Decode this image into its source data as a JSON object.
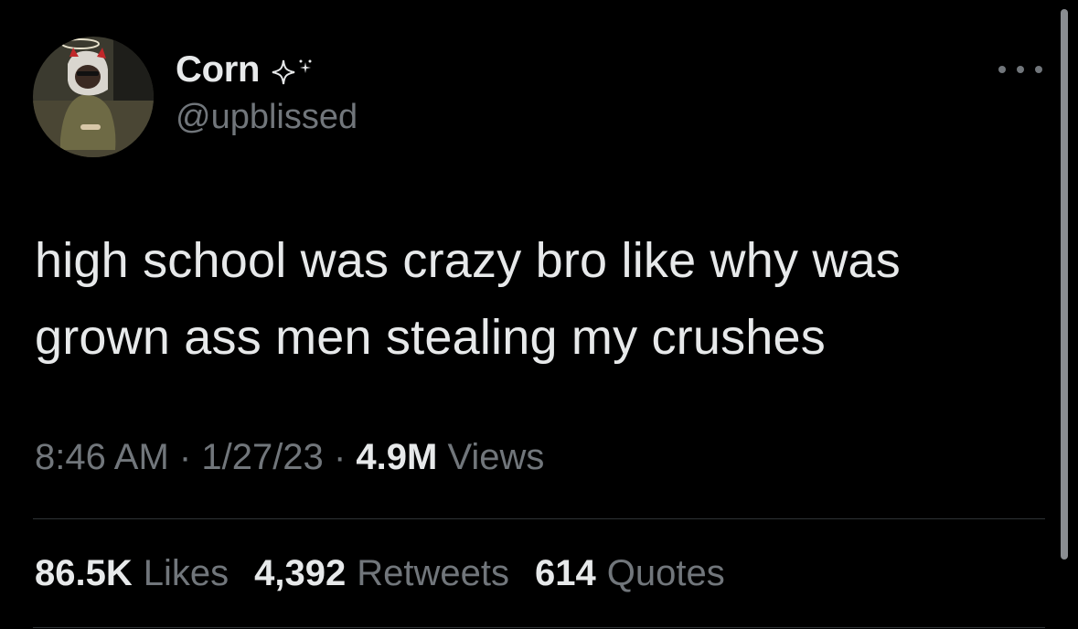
{
  "tweet": {
    "display_name": "Corn",
    "name_icon": "sparkle-icon",
    "handle": "@upblissed",
    "more_icon": "more-icon",
    "text_lines": [
      "high school was crazy bro like why was",
      "grown ass men stealing my crushes"
    ],
    "time": "8:46 AM",
    "separator": "·",
    "date": "1/27/23",
    "views_count": "4.9M",
    "views_label": "Views",
    "stats": {
      "likes_count": "86.5K",
      "likes_label": "Likes",
      "retweets_count": "4,392",
      "retweets_label": "Retweets",
      "quotes_count": "614",
      "quotes_label": "Quotes"
    }
  },
  "colors": {
    "background": "#000000",
    "primary_text": "#e7e9ea",
    "secondary_text": "#71767b",
    "divider": "#2f3336"
  }
}
